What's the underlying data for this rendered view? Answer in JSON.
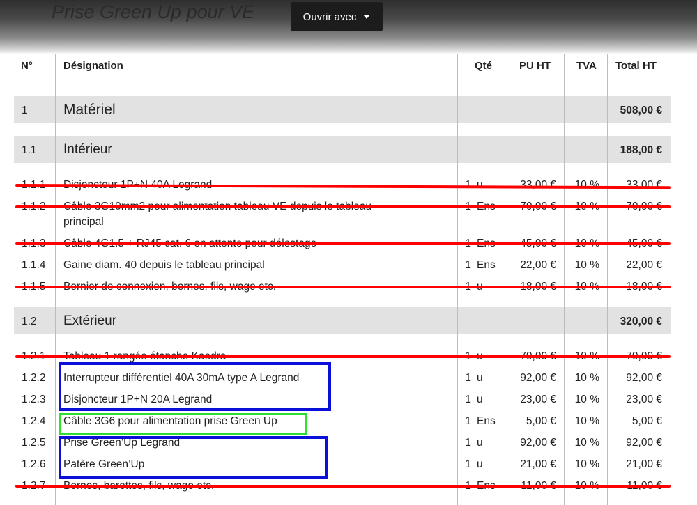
{
  "header": {
    "title": "Prise Green Up pour VE",
    "open_button": "Ouvrir avec"
  },
  "table": {
    "columns": {
      "num": "N°",
      "designation": "Désignation",
      "qty": "Qté",
      "pu": "PU HT",
      "tva": "TVA",
      "total": "Total HT"
    },
    "section": {
      "num": "1",
      "label": "Matériel",
      "total": "508,00 €"
    },
    "groups": [
      {
        "num": "1.1",
        "label": "Intérieur",
        "total": "188,00 €",
        "rows": [
          {
            "num": "1.1.1",
            "designation": "Disjoncteur 1P+N 40A Legrand",
            "designation2": "",
            "qty": "1",
            "unit": "u",
            "pu": "33,00 €",
            "tva": "10 %",
            "total": "33,00 €",
            "struck": true
          },
          {
            "num": "1.1.2",
            "designation": "Câble 3G10mm2 pour alimentation tableau VE depuis le tableau",
            "designation2": "principal",
            "qty": "1",
            "unit": "Ens",
            "pu": "70,00 €",
            "tva": "10 %",
            "total": "70,00 €",
            "struck": true
          },
          {
            "num": "1.1.3",
            "designation": "Câble 4G1.5 + RJ45 cat. 6 en attente pour délestage",
            "designation2": "",
            "qty": "1",
            "unit": "Ens",
            "pu": "45,00 €",
            "tva": "10 %",
            "total": "45,00 €",
            "struck": true
          },
          {
            "num": "1.1.4",
            "designation": "Gaine diam. 40 depuis le tableau principal",
            "designation2": "",
            "qty": "1",
            "unit": "Ens",
            "pu": "22,00 €",
            "tva": "10 %",
            "total": "22,00 €",
            "struck": false
          },
          {
            "num": "1.1.5",
            "designation": "Bornier de connexion, bornes, fils, wago etc.",
            "designation2": "",
            "qty": "1",
            "unit": "u",
            "pu": "18,00 €",
            "tva": "10 %",
            "total": "18,00 €",
            "struck": true
          }
        ]
      },
      {
        "num": "1.2",
        "label": "Extérieur",
        "total": "320,00 €",
        "rows": [
          {
            "num": "1.2.1",
            "designation": "Tableau 1 rangée étanche Kaedra",
            "designation2": "",
            "qty": "1",
            "unit": "u",
            "pu": "70,00 €",
            "tva": "10 %",
            "total": "70,00 €",
            "struck": true
          },
          {
            "num": "1.2.2",
            "designation": "Interrupteur différentiel 40A 30mA type A Legrand",
            "designation2": "",
            "qty": "1",
            "unit": "u",
            "pu": "92,00 €",
            "tva": "10 %",
            "total": "92,00 €",
            "struck": false
          },
          {
            "num": "1.2.3",
            "designation": "Disjoncteur 1P+N 20A Legrand",
            "designation2": "",
            "qty": "1",
            "unit": "u",
            "pu": "23,00 €",
            "tva": "10 %",
            "total": "23,00 €",
            "struck": false
          },
          {
            "num": "1.2.4",
            "designation": "Câble 3G6 pour alimentation prise Green Up",
            "designation2": "",
            "qty": "1",
            "unit": "Ens",
            "pu": "5,00 €",
            "tva": "10 %",
            "total": "5,00 €",
            "struck": false
          },
          {
            "num": "1.2.5",
            "designation": "Prise Green’Up Legrand",
            "designation2": "",
            "qty": "1",
            "unit": "u",
            "pu": "92,00 €",
            "tva": "10 %",
            "total": "92,00 €",
            "struck": false
          },
          {
            "num": "1.2.6",
            "designation": "Patère Green’Up",
            "designation2": "",
            "qty": "1",
            "unit": "u",
            "pu": "21,00 €",
            "tva": "10 %",
            "total": "21,00 €",
            "struck": false
          },
          {
            "num": "1.2.7",
            "designation": "Bornes, barettes, fils, wago etc.",
            "designation2": "",
            "qty": "1",
            "unit": "Ens",
            "pu": "11,00 €",
            "tva": "10 %",
            "total": "11,00 €",
            "struck": true
          }
        ]
      }
    ]
  },
  "annotations": {
    "strike_color": "#ff0000",
    "blue_box_color": "#0a10d8",
    "green_box_color": "#2ee02e"
  }
}
